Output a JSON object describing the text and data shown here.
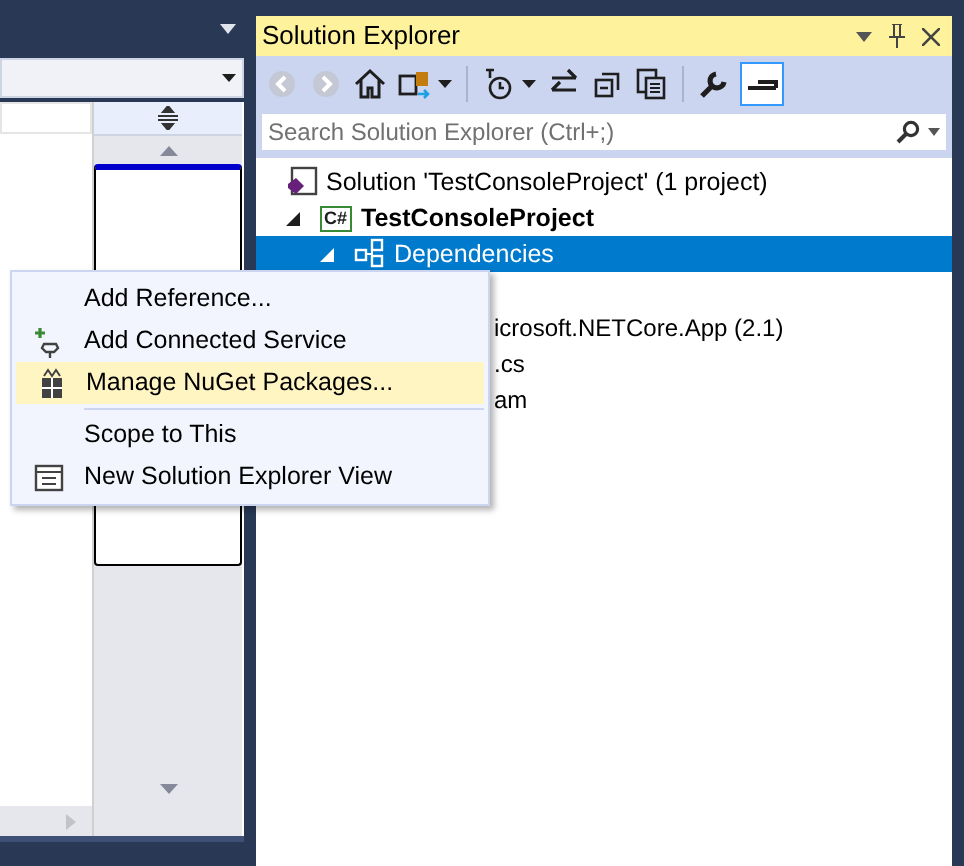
{
  "solution_explorer": {
    "title": "Solution Explorer",
    "toolbar": [
      {
        "kind": "back",
        "disabled": true
      },
      {
        "kind": "forward",
        "disabled": true
      },
      {
        "kind": "home",
        "disabled": false
      },
      {
        "kind": "switch_views",
        "disabled": false
      },
      {
        "kind": "separator"
      },
      {
        "kind": "pending_changes",
        "disabled": false
      },
      {
        "kind": "sync",
        "disabled": false
      },
      {
        "kind": "collapse",
        "disabled": false
      },
      {
        "kind": "show_all",
        "disabled": false
      },
      {
        "kind": "separator"
      },
      {
        "kind": "properties",
        "disabled": false
      },
      {
        "kind": "preview",
        "disabled": false,
        "selected": true
      }
    ],
    "search": {
      "placeholder": "Search Solution Explorer (Ctrl+;)"
    },
    "tree": [
      {
        "label": "Solution 'TestConsoleProject' (1 project)",
        "kind": "solution",
        "selected": false,
        "children": [
          {
            "label": "TestConsoleProject",
            "badge": "C#",
            "kind": "project",
            "expanded": true,
            "selected": false,
            "children": [
              {
                "label": "Dependencies",
                "kind": "dependencies",
                "expanded": true,
                "selected": true,
                "children": [
                  {
                    "label": "icrosoft.NETCore.App (2.1)",
                    "kind": "covered",
                    "selected": false
                  }
                ]
              },
              {
                "label": ".cs",
                "kind": "covered",
                "selected": false
              },
              {
                "label": "am",
                "kind": "covered",
                "selected": false
              }
            ]
          }
        ]
      }
    ]
  },
  "context_menu": {
    "items": [
      {
        "kind": "plain",
        "label": "Add Reference...",
        "highlighted": false
      },
      {
        "kind": "service",
        "label": "Add Connected Service",
        "highlighted": false
      },
      {
        "kind": "package",
        "label": "Manage NuGet Packages...",
        "highlighted": true
      },
      {
        "kind": "separator"
      },
      {
        "kind": "plain",
        "label": "Scope to This",
        "highlighted": false
      },
      {
        "kind": "view",
        "label": "New Solution Explorer View",
        "highlighted": false
      }
    ]
  }
}
